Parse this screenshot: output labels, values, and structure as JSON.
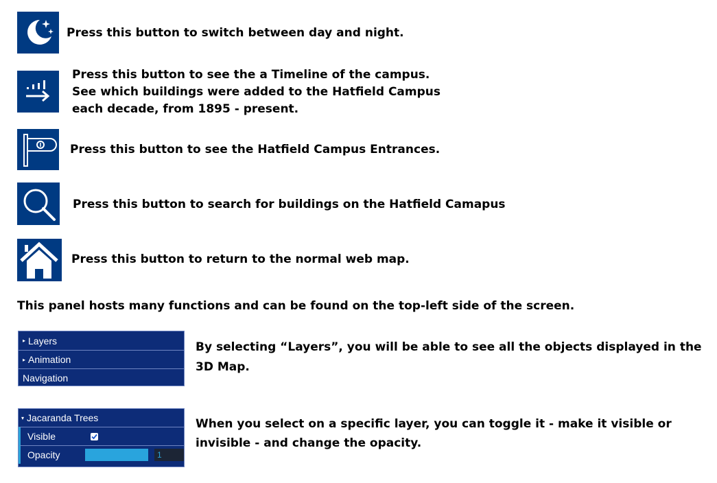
{
  "instructions": [
    {
      "icon": "moon-stars-icon",
      "lines": [
        "Press this button to switch between day and night."
      ]
    },
    {
      "icon": "timeline-icon",
      "lines": [
        "Press this button to see the a Timeline of the campus.",
        "See which buildings were added to the Hatfield Campus",
        "each decade,  from 1895 - present."
      ]
    },
    {
      "icon": "entrance-sign-icon",
      "lines": [
        "Press this button to see the Hatfield Campus Entrances."
      ]
    },
    {
      "icon": "search-icon",
      "lines": [
        "Press this button to search for buildings on the Hatfield Camapus"
      ]
    },
    {
      "icon": "home-icon",
      "lines": [
        "Press this button to return to the normal web map."
      ]
    }
  ],
  "panel_intro": "This panel hosts many functions and can be found on the top-left side of the screen.",
  "panel1": {
    "items": [
      {
        "label": "Layers",
        "collapsed": true
      },
      {
        "label": "Animation",
        "collapsed": true
      },
      {
        "label": "Navigation",
        "collapsed": false
      }
    ],
    "description": [
      "By selecting “Layers”, you will be able to see all the objects displayed in the",
      "3D Map."
    ]
  },
  "panel2": {
    "header": "Jacaranda Trees",
    "visible_label": "Visible",
    "visible_checked": true,
    "opacity_label": "Opacity",
    "opacity_value": "1",
    "opacity_fraction": 1,
    "description": [
      "When you select on a specific layer, you can toggle it - make it visible or",
      "invisible - and change the opacity."
    ]
  },
  "colors": {
    "button_bg": "#003a82",
    "panel_bg": "#0d2c78",
    "slider": "#29a4dd"
  }
}
